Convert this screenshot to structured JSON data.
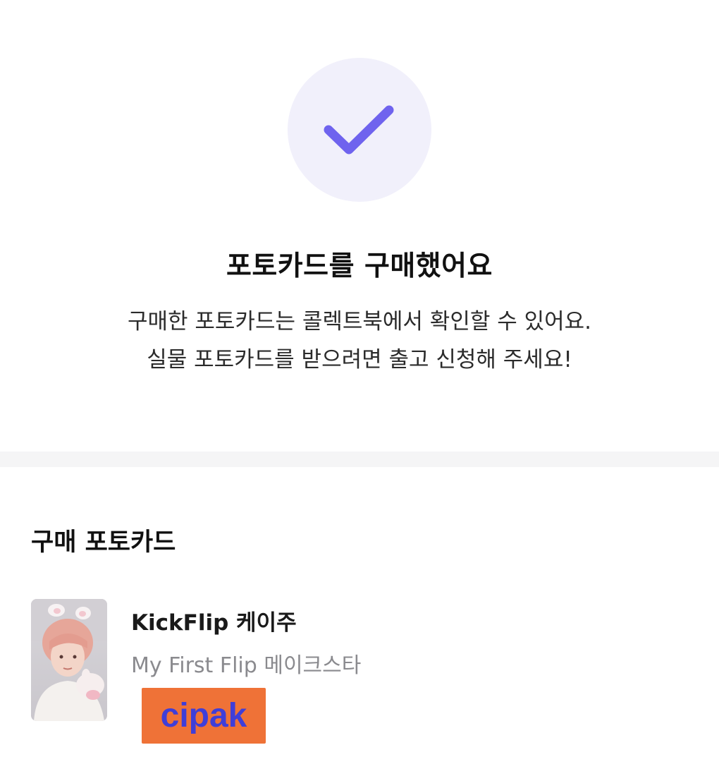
{
  "success": {
    "icon": "check-icon",
    "badge_color": "#f1f0fb",
    "check_color": "#6f63ee",
    "title": "포토카드를 구매했어요",
    "description_line1": "구매한 포토카드는 콜렉트북에서 확인할 수 있어요.",
    "description_line2": "실물 포토카드를 받으려면 출고 신청해 주세요!"
  },
  "purchased_section": {
    "title": "구매 포토카드",
    "items": [
      {
        "title": "KickFlip 케이주",
        "subtitle": "My First Flip 메이크스타",
        "thumbnail": "photocard-image"
      }
    ]
  },
  "watermark": {
    "text": "cipak",
    "background": "#ef7237",
    "color": "#3f3ed8"
  }
}
